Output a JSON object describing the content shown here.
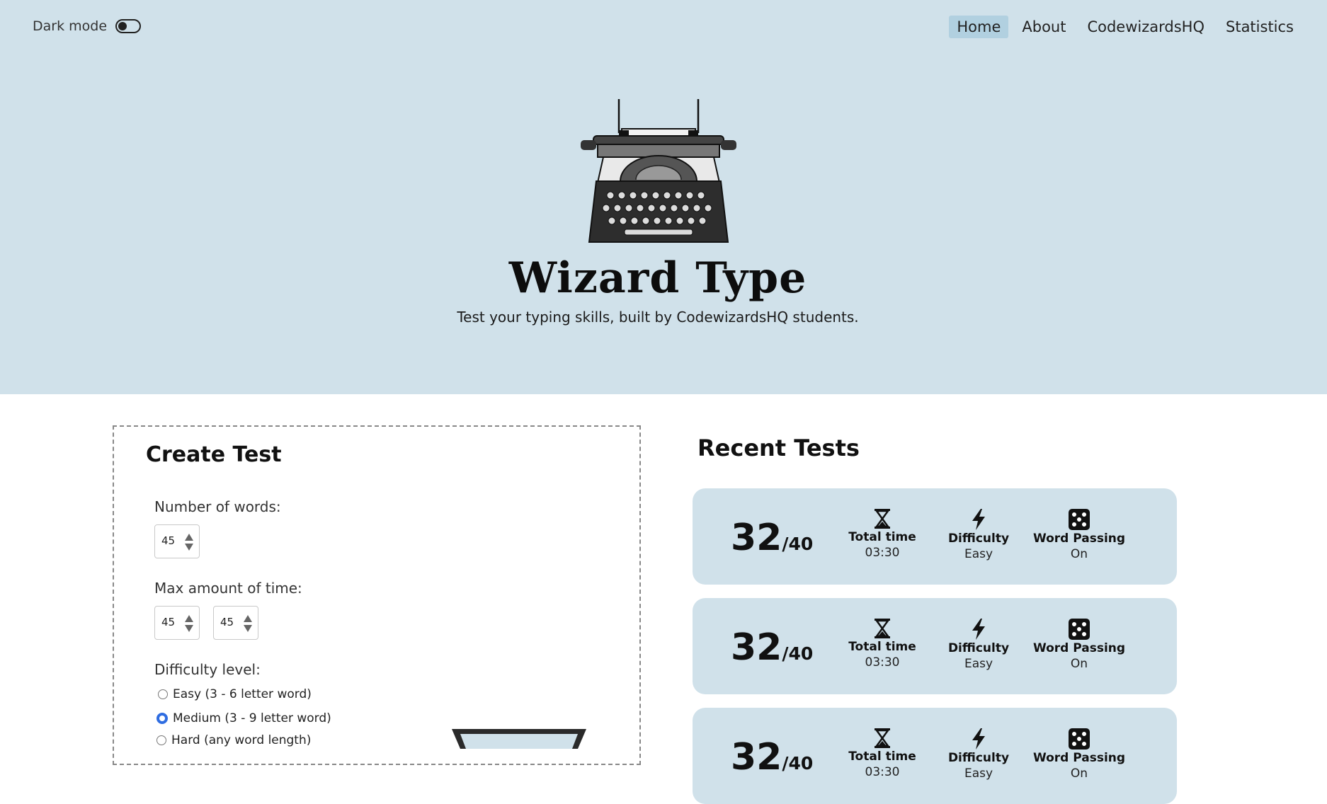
{
  "header": {
    "dark_mode_label": "Dark mode",
    "nav": [
      {
        "label": "Home",
        "active": true
      },
      {
        "label": "About"
      },
      {
        "label": "CodewizardsHQ"
      },
      {
        "label": "Statistics"
      }
    ],
    "title": "Wizard Type",
    "subtitle": "Test your typing skills, built by CodewizardsHQ students."
  },
  "create_test": {
    "heading": "Create Test",
    "words_label": "Number of words:",
    "words_value": "45",
    "time_label": "Max amount of time:",
    "time_minutes": "45",
    "time_seconds": "45",
    "difficulty_label": "Difficulty level:",
    "difficulty_options": [
      {
        "label": "Easy (3 - 6 letter word)",
        "selected": false
      },
      {
        "label": "Medium  (3 - 9 letter word)",
        "selected": true
      },
      {
        "label": "Hard (any word length)",
        "selected": false
      }
    ]
  },
  "recent": {
    "heading": "Recent Tests",
    "cards": [
      {
        "score": "32",
        "total": "/40",
        "time_label": "Total time",
        "time": "03:30",
        "difficulty_label": "Difficulty",
        "difficulty": "Easy",
        "passing_label": "Word Passing",
        "passing": "On"
      },
      {
        "score": "32",
        "total": "/40",
        "time_label": "Total time",
        "time": "03:30",
        "difficulty_label": "Difficulty",
        "difficulty": "Easy",
        "passing_label": "Word Passing",
        "passing": "On"
      },
      {
        "score": "32",
        "total": "/40",
        "time_label": "Total time",
        "time": "03:30",
        "difficulty_label": "Difficulty",
        "difficulty": "Easy",
        "passing_label": "Word Passing",
        "passing": "On"
      }
    ]
  },
  "colors": {
    "hero_bg": "#d0e1ea",
    "card_bg": "#d0e1ea",
    "nav_active": "#b1d0e0",
    "radio_accent": "#2f6de1"
  },
  "icons": [
    "typewriter-icon",
    "hourglass-icon",
    "lightning-icon",
    "dice-icon"
  ]
}
